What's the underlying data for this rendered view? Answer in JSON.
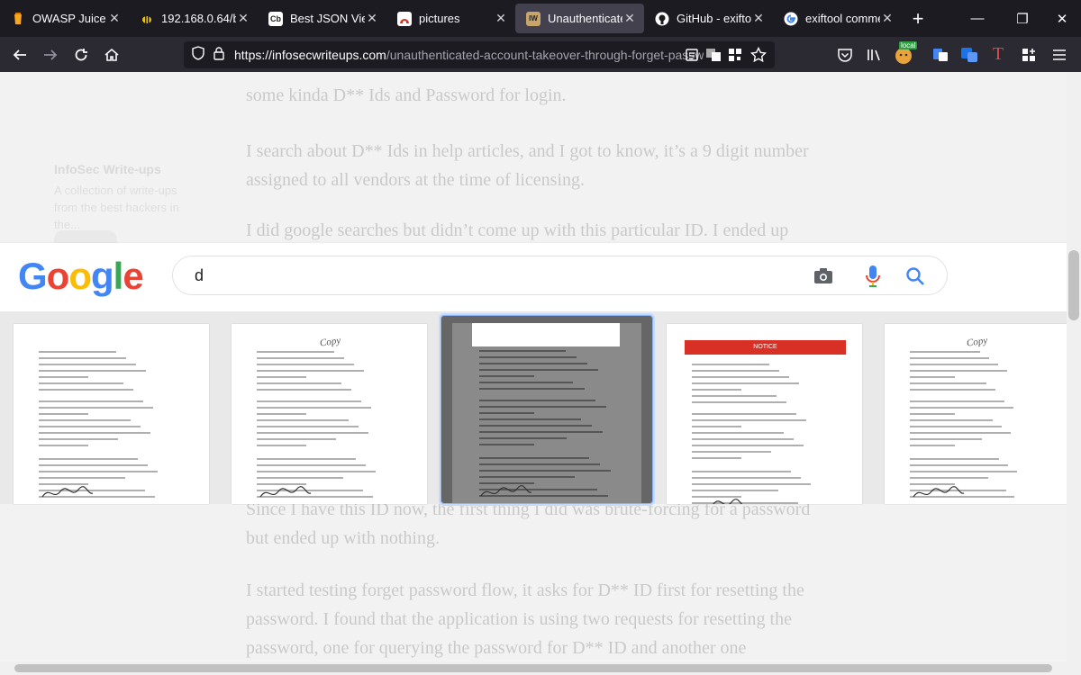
{
  "browser": {
    "tabs": [
      {
        "label": "OWASP Juice Sho",
        "icon": "juice-shop-icon"
      },
      {
        "label": "192.168.0.64/bWA",
        "icon": "bee-icon"
      },
      {
        "label": "Best JSON Viewer",
        "icon": "cb-icon",
        "icon_text": "Cb"
      },
      {
        "label": "pictures",
        "icon": "pictures-icon"
      },
      {
        "label": "Unauthenticated",
        "icon": "infosec-icon",
        "icon_text": "IW",
        "active": true
      },
      {
        "label": "GitHub - exiftool/",
        "icon": "github-icon"
      },
      {
        "label": "exiftool comment",
        "icon": "google-icon"
      }
    ],
    "url_host": "https://infosecwriteups.com",
    "url_path": "/unauthenticated-account-takeover-through-forget-passw",
    "local_badge": "local"
  },
  "article": {
    "paragraphs": [
      "some kinda D** Ids and Password for login.",
      "I search about D** Ids in help articles, and I got to know, it’s a 9 digit number assigned to all vendors at the time of licensing.",
      "I did google searches but didn’t come up with this particular ID. I ended up",
      "Since I have this ID now, the first thing I did was brute-forcing for a password but ended up with nothing.",
      "I started testing forget password flow, it asks for D** ID first for resetting the password. I found that the application is using two requests for resetting the password, one for querying the password for D** ID and another one"
    ],
    "publication": {
      "name": "InfoSec Write-ups",
      "description": "A collection of write-ups from the best hackers in the..."
    }
  },
  "google": {
    "logo": "Google",
    "query": "d",
    "logo_colors": [
      "#4285F4",
      "#EA4335",
      "#FBBC05",
      "#4285F4",
      "#34A853",
      "#EA4335"
    ]
  },
  "image_results": [
    {
      "name": "letter-1"
    },
    {
      "name": "letter-2",
      "stamp": "Copy"
    },
    {
      "name": "letter-3"
    },
    {
      "name": "form-4",
      "banner": "NOTICE"
    },
    {
      "name": "letter-5",
      "stamp": "Copy"
    }
  ]
}
